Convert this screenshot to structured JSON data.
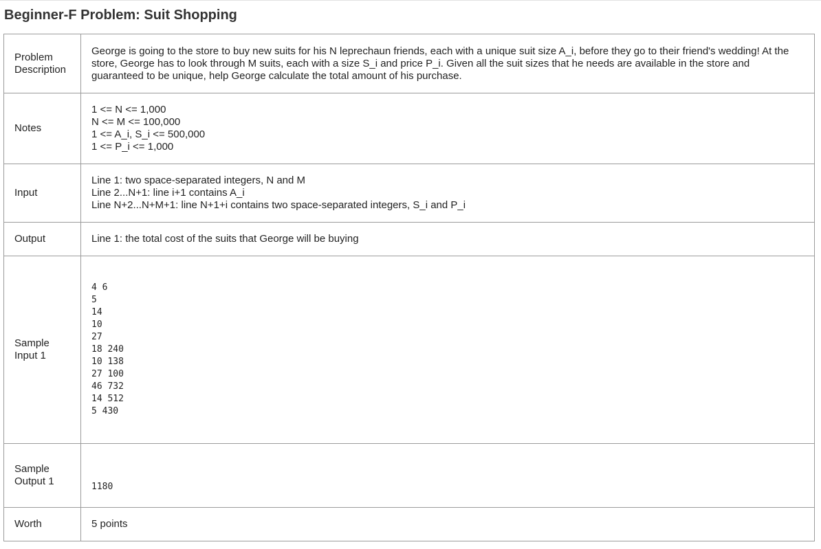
{
  "page": {
    "title": "Beginner-F Problem: Suit Shopping"
  },
  "rows": {
    "description": {
      "label_lines": [
        "Problem",
        "Description"
      ],
      "text": "George is going to the store to buy new suits for his N leprechaun friends, each with a unique suit size A_i, before they go to their friend's wedding! At the store, George has to look through M suits, each with a size S_i and price P_i. Given all the suit sizes that he needs are available in the store and guaranteed to be unique, help George calculate the total amount of his purchase."
    },
    "notes": {
      "label": "Notes",
      "lines": [
        "1 <= N <= 1,000",
        "N <= M <= 100,000",
        "1 <= A_i, S_i <= 500,000",
        "1 <= P_i <= 1,000"
      ]
    },
    "input": {
      "label": "Input",
      "lines": [
        "Line 1: two space-separated integers, N and M",
        "Line 2...N+1: line i+1 contains A_i",
        "Line N+2...N+M+1: line N+1+i contains two space-separated integers, S_i and P_i"
      ]
    },
    "output": {
      "label": "Output",
      "text": "Line 1: the total cost of the suits that George will be buying"
    },
    "sample_input": {
      "label_lines": [
        "Sample",
        "Input 1"
      ],
      "lines": [
        "4 6",
        "5",
        "14",
        "10",
        "27",
        "18 240",
        "10 138",
        "27 100",
        "46 732",
        "14 512",
        "5 430"
      ]
    },
    "sample_output": {
      "label_lines": [
        "Sample",
        "Output 1"
      ],
      "text": "1180"
    },
    "worth": {
      "label": "Worth",
      "text": "5 points"
    }
  }
}
